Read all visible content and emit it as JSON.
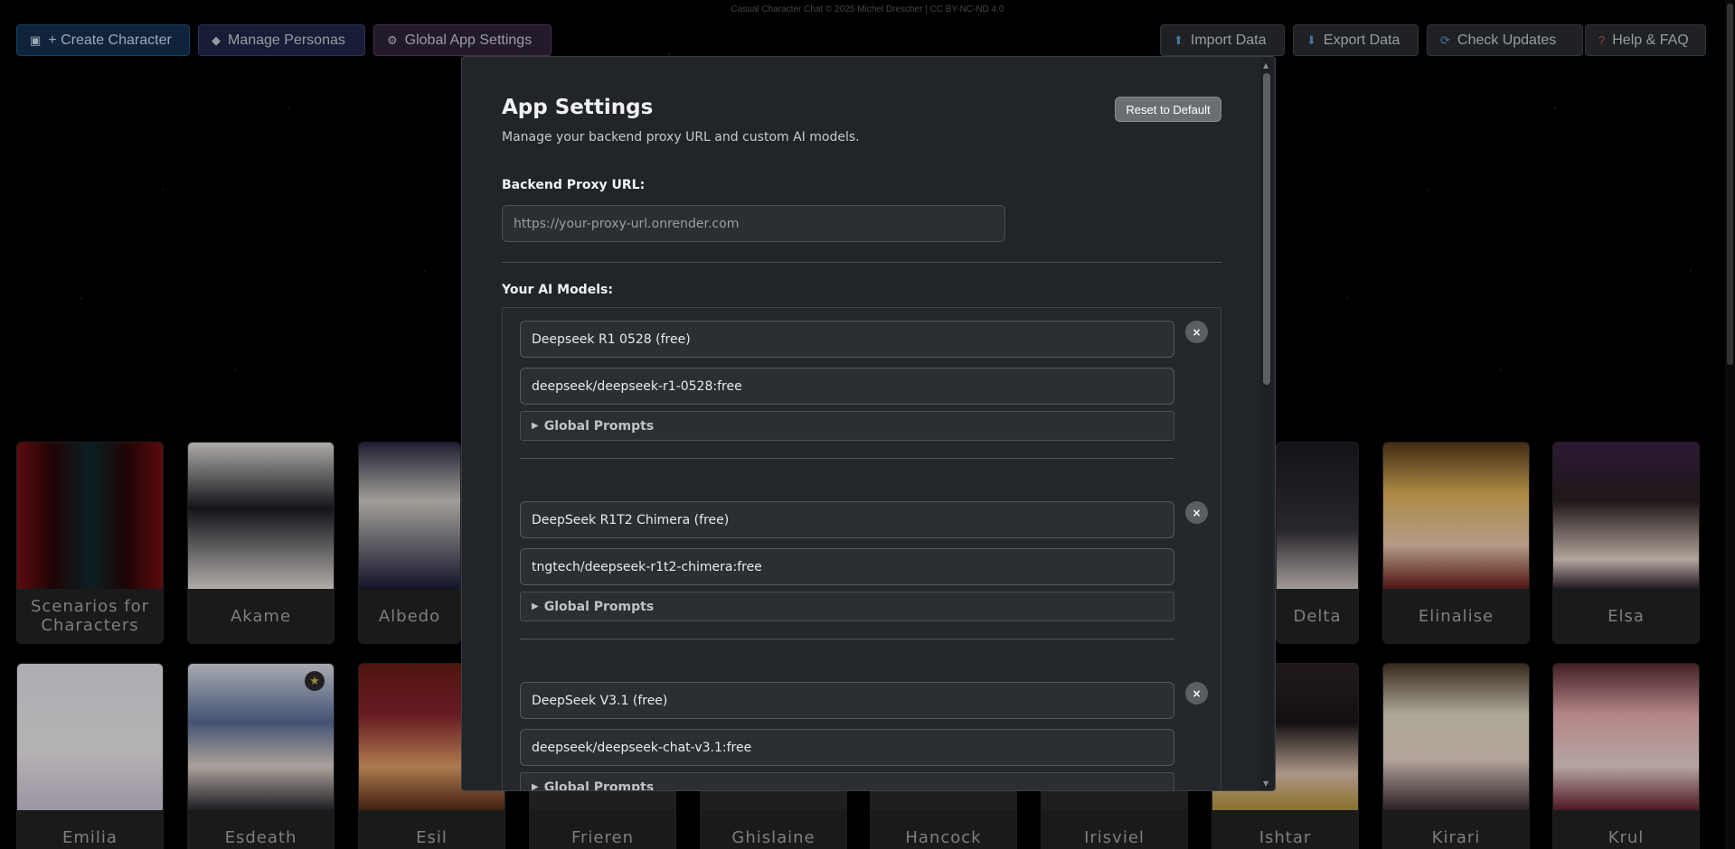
{
  "copyright": "Casual Character Chat © 2025 Michel Drescher | CC BY-NC-ND 4.0",
  "toolbar": {
    "create_character": "+ Create Character",
    "manage_personas": "Manage Personas",
    "global_settings": "Global App Settings",
    "import_data": "Import Data",
    "export_data": "Export Data",
    "check_updates": "Check Updates",
    "help_faq": "Help & FAQ"
  },
  "characters_row1": [
    "Scenarios for Characters",
    "Akame",
    "Albedo",
    "Delta",
    "Elinalise",
    "Elsa"
  ],
  "characters_row2": [
    "Emilia",
    "Esdeath",
    "Esil",
    "Frieren",
    "Ghislaine",
    "Hancock",
    "Irisviel",
    "Ishtar",
    "Kirari",
    "Krul"
  ],
  "modal": {
    "title": "App Settings",
    "subtitle": "Manage your backend proxy URL and custom AI models.",
    "reset_label": "Reset to Default",
    "proxy_label": "Backend Proxy URL:",
    "proxy_placeholder": "https://your-proxy-url.onrender.com",
    "models_label": "Your AI Models:",
    "models": [
      {
        "name": "Deepseek R1 0528 (free)",
        "id": "deepseek/deepseek-r1-0528:free",
        "prompts_label": "Global Prompts"
      },
      {
        "name": "DeepSeek R1T2 Chimera (free)",
        "id": "tngtech/deepseek-r1t2-chimera:free",
        "prompts_label": "Global Prompts"
      },
      {
        "name": "DeepSeek V3.1 (free)",
        "id": "deepseek/deepseek-chat-v3.1:free",
        "prompts_label": "Global Prompts"
      }
    ]
  },
  "colors": {
    "modal_bg": "#212529",
    "create_btn": "#14304f",
    "persona_btn": "#22264a",
    "global_btn": "#2e2338"
  }
}
